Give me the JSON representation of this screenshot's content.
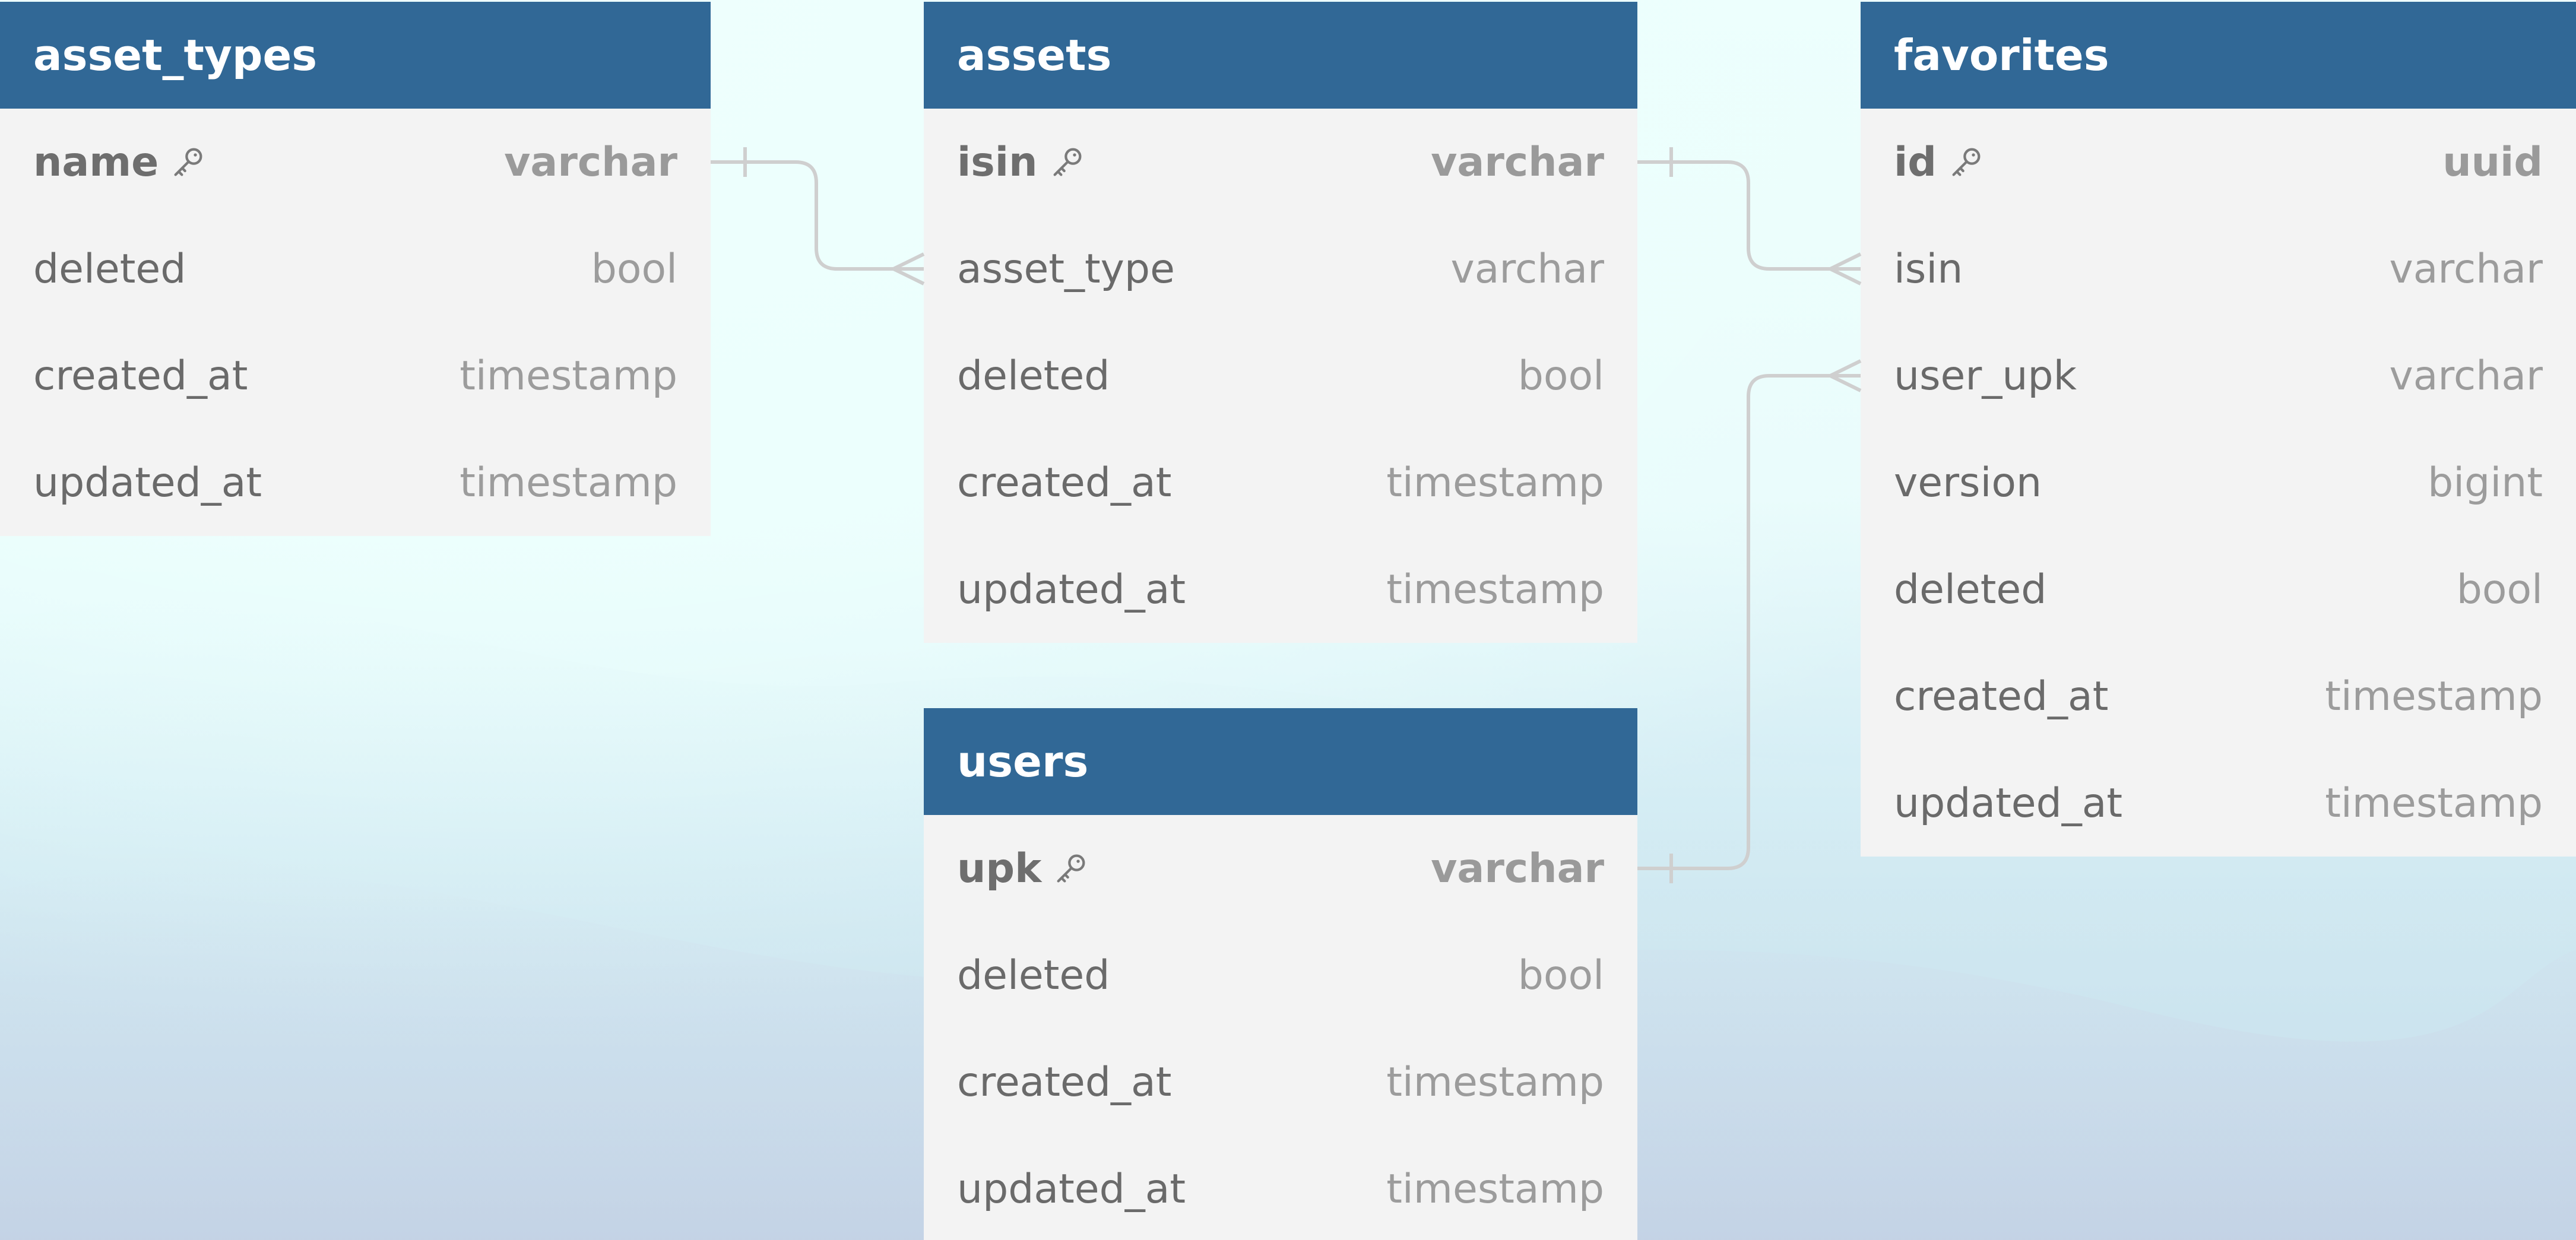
{
  "colors": {
    "header_bg": "#316896",
    "header_text": "#ffffff",
    "table_bg": "#f3f3f3",
    "column_name": "#6a6a6a",
    "column_type": "#9c9c9c",
    "connector": "#cfcfcf"
  },
  "tables": {
    "asset_types": {
      "title": "asset_types",
      "columns": [
        {
          "name": "name",
          "type": "varchar",
          "primary_key": true
        },
        {
          "name": "deleted",
          "type": "bool"
        },
        {
          "name": "created_at",
          "type": "timestamp"
        },
        {
          "name": "updated_at",
          "type": "timestamp"
        }
      ]
    },
    "assets": {
      "title": "assets",
      "columns": [
        {
          "name": "isin",
          "type": "varchar",
          "primary_key": true
        },
        {
          "name": "asset_type",
          "type": "varchar"
        },
        {
          "name": "deleted",
          "type": "bool"
        },
        {
          "name": "created_at",
          "type": "timestamp"
        },
        {
          "name": "updated_at",
          "type": "timestamp"
        }
      ]
    },
    "favorites": {
      "title": "favorites",
      "columns": [
        {
          "name": "id",
          "type": "uuid",
          "primary_key": true
        },
        {
          "name": "isin",
          "type": "varchar"
        },
        {
          "name": "user_upk",
          "type": "varchar"
        },
        {
          "name": "version",
          "type": "bigint"
        },
        {
          "name": "deleted",
          "type": "bool"
        },
        {
          "name": "created_at",
          "type": "timestamp"
        },
        {
          "name": "updated_at",
          "type": "timestamp"
        }
      ]
    },
    "users": {
      "title": "users",
      "columns": [
        {
          "name": "upk",
          "type": "varchar",
          "primary_key": true
        },
        {
          "name": "deleted",
          "type": "bool"
        },
        {
          "name": "created_at",
          "type": "timestamp"
        },
        {
          "name": "updated_at",
          "type": "timestamp"
        }
      ]
    }
  },
  "relationships": [
    {
      "from": "asset_types.name",
      "to": "assets.asset_type",
      "from_cardinality": "one",
      "to_cardinality": "many"
    },
    {
      "from": "assets.isin",
      "to": "favorites.isin",
      "from_cardinality": "one",
      "to_cardinality": "many"
    },
    {
      "from": "users.upk",
      "to": "favorites.user_upk",
      "from_cardinality": "one",
      "to_cardinality": "many"
    }
  ]
}
